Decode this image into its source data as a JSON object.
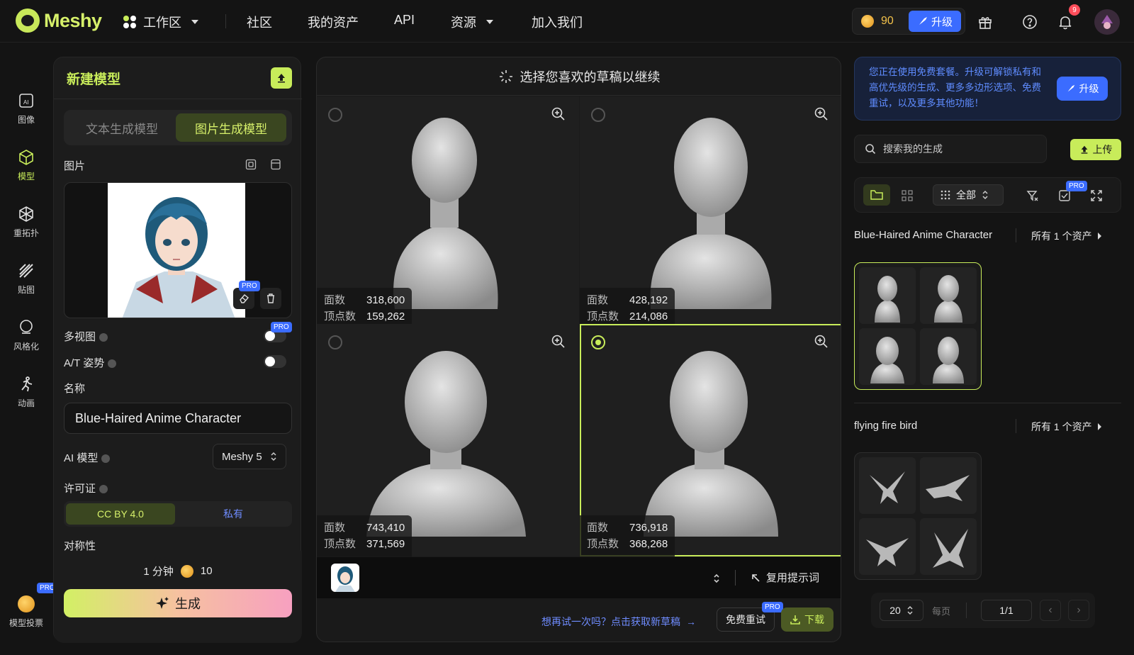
{
  "brand": {
    "name": "Meshy"
  },
  "nav": {
    "workspace": "工作区",
    "community": "社区",
    "assets": "我的资产",
    "api": "API",
    "resources": "资源",
    "join": "加入我们"
  },
  "account": {
    "credits": "90",
    "upgrade": "升级",
    "notifications": "9"
  },
  "rail": [
    {
      "label": "图像"
    },
    {
      "label": "模型"
    },
    {
      "label": "重拓扑"
    },
    {
      "label": "贴图"
    },
    {
      "label": "风格化"
    },
    {
      "label": "动画"
    },
    {
      "label": "模型投票"
    }
  ],
  "panel": {
    "title": "新建模型",
    "tabs": [
      "文本生成模型",
      "图片生成模型"
    ],
    "image_label": "图片",
    "multiview": "多视图",
    "pose": "A/T 姿势",
    "name_label": "名称",
    "name_value": "Blue-Haired Anime Character",
    "ai_model_label": "AI 模型",
    "ai_model_value": "Meshy 5",
    "license_label": "许可证",
    "license_options": [
      "CC BY 4.0",
      "私有"
    ],
    "symmetry_label": "对称性",
    "time": "1 分钟",
    "cost": "10",
    "generate": "生成",
    "pro": "PRO"
  },
  "center": {
    "header": "选择您喜欢的草稿以继续",
    "face_label": "面数",
    "vertex_label": "顶点数",
    "drafts": [
      {
        "faces": "318,600",
        "vertices": "159,262",
        "selected": false
      },
      {
        "faces": "428,192",
        "vertices": "214,086",
        "selected": false
      },
      {
        "faces": "743,410",
        "vertices": "371,569",
        "selected": false
      },
      {
        "faces": "736,918",
        "vertices": "368,268",
        "selected": true
      }
    ],
    "reuse_prompt": "复用提示词",
    "retry_hint": "想再试一次吗？点击获取新草稿",
    "free_retry": "免费重试",
    "download": "下载"
  },
  "right": {
    "promo": "您正在使用免费套餐。升级可解锁私有和高优先级的生成、更多多边形选项、免费重试，以及更多其他功能！",
    "upgrade": "升级",
    "search_placeholder": "搜索我的生成",
    "upload": "上传",
    "filter_all": "全部",
    "groups": [
      {
        "title": "Blue-Haired Anime Character",
        "count": "所有 1 个资产"
      },
      {
        "title": "flying fire bird",
        "count": "所有 1 个资产"
      }
    ],
    "page_size": "20",
    "per_page": "每页",
    "page": "1/1"
  },
  "colors": {
    "accent": "#c8ec5a",
    "blue": "#3b6cff",
    "bg": "#141414"
  }
}
